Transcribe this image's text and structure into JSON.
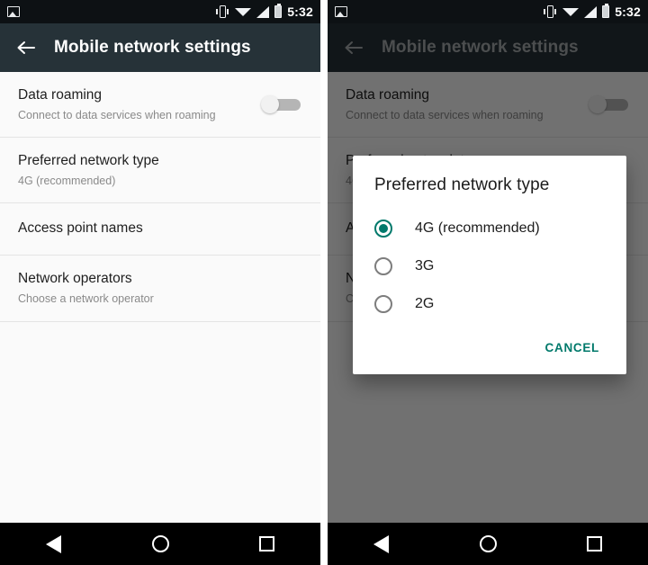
{
  "status_bar": {
    "icons": [
      "screenshot-icon",
      "vibrate-icon",
      "wifi-icon",
      "signal-icon",
      "battery-icon"
    ],
    "time": "5:32"
  },
  "app_bar": {
    "back_icon": "back-arrow-icon",
    "title": "Mobile network settings"
  },
  "settings_list": [
    {
      "title": "Data roaming",
      "subtitle": "Connect to data services when roaming",
      "control": "toggle",
      "toggle_state": "off"
    },
    {
      "title": "Preferred network type",
      "subtitle": "4G (recommended)",
      "control": "none"
    },
    {
      "title": "Access point names",
      "subtitle": "",
      "control": "none"
    },
    {
      "title": "Network operators",
      "subtitle": "Choose a network operator",
      "control": "none"
    }
  ],
  "dialog": {
    "title": "Preferred network type",
    "options": [
      {
        "label": "4G (recommended)",
        "selected": true
      },
      {
        "label": "3G",
        "selected": false
      },
      {
        "label": "2G",
        "selected": false
      }
    ],
    "cancel_label": "CANCEL"
  },
  "nav_bar": {
    "back": "nav-back-icon",
    "home": "nav-home-icon",
    "recents": "nav-recents-icon"
  },
  "colors": {
    "status_bar_bg": "#0d1114",
    "app_bar_bg": "#263238",
    "content_bg": "#fafafa",
    "accent_teal": "#00796b",
    "nav_bar_bg": "#000000",
    "scrim": "rgba(0,0,0,0.55)",
    "toggle_track_off": "#b5b5b5",
    "primary_text": "#1f1f1f",
    "secondary_text": "#8a8a8a"
  }
}
